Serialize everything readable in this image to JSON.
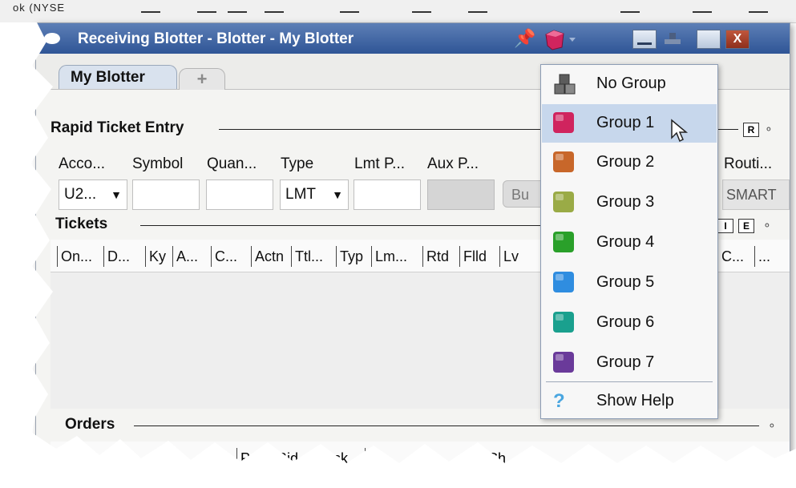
{
  "background": {
    "cut_text": "ok (NYSE"
  },
  "window": {
    "title": "Receiving Blotter - Blotter - My Blotter",
    "accent": "#2f5596"
  },
  "tabs": [
    {
      "label": "My Blotter"
    },
    {
      "label": "+"
    }
  ],
  "rapid_ticket": {
    "title": "Rapid Ticket Entry",
    "button_r": "R",
    "fields": [
      {
        "label": "Acco...",
        "value": "U2..."
      },
      {
        "label": "Symbol",
        "value": ""
      },
      {
        "label": "Quan...",
        "value": ""
      },
      {
        "label": "Type",
        "value": "LMT"
      },
      {
        "label": "Lmt P...",
        "value": ""
      },
      {
        "label": "Aux P...",
        "value": ""
      }
    ],
    "buy_label": "Bu",
    "routing_label": "Routi...",
    "routing_value": "SMART"
  },
  "tickets": {
    "title": "Tickets",
    "button_i": "I",
    "button_e": "E",
    "columns": [
      "On...",
      "D...",
      "Ky",
      "A...",
      "C...",
      "Actn",
      "Ttl...",
      "Typ",
      "Lm...",
      "Rtd",
      "Flld",
      "Lv",
      "C...",
      "..."
    ]
  },
  "orders": {
    "title": "Orders",
    "columns": [
      "P",
      "Bid",
      "Ask",
      "As...",
      "Ch"
    ]
  },
  "group_menu": {
    "items": [
      {
        "label": "No Group",
        "icon": "stack-icon",
        "color": "#7a7a7a"
      },
      {
        "label": "Group 1",
        "icon": "cube-icon",
        "color": "#d0245e",
        "highlighted": true
      },
      {
        "label": "Group 2",
        "icon": "cube-icon",
        "color": "#c8672a"
      },
      {
        "label": "Group 3",
        "icon": "cube-icon",
        "color": "#9aab46"
      },
      {
        "label": "Group 4",
        "icon": "cube-icon",
        "color": "#2aa02a"
      },
      {
        "label": "Group 5",
        "icon": "cube-icon",
        "color": "#2f8de0"
      },
      {
        "label": "Group 6",
        "icon": "cube-icon",
        "color": "#1aa08e"
      },
      {
        "label": "Group 7",
        "icon": "cube-icon",
        "color": "#6a3a9a"
      },
      {
        "label": "Show Help",
        "icon": "help-icon",
        "color": "#4aa6e0"
      }
    ]
  }
}
